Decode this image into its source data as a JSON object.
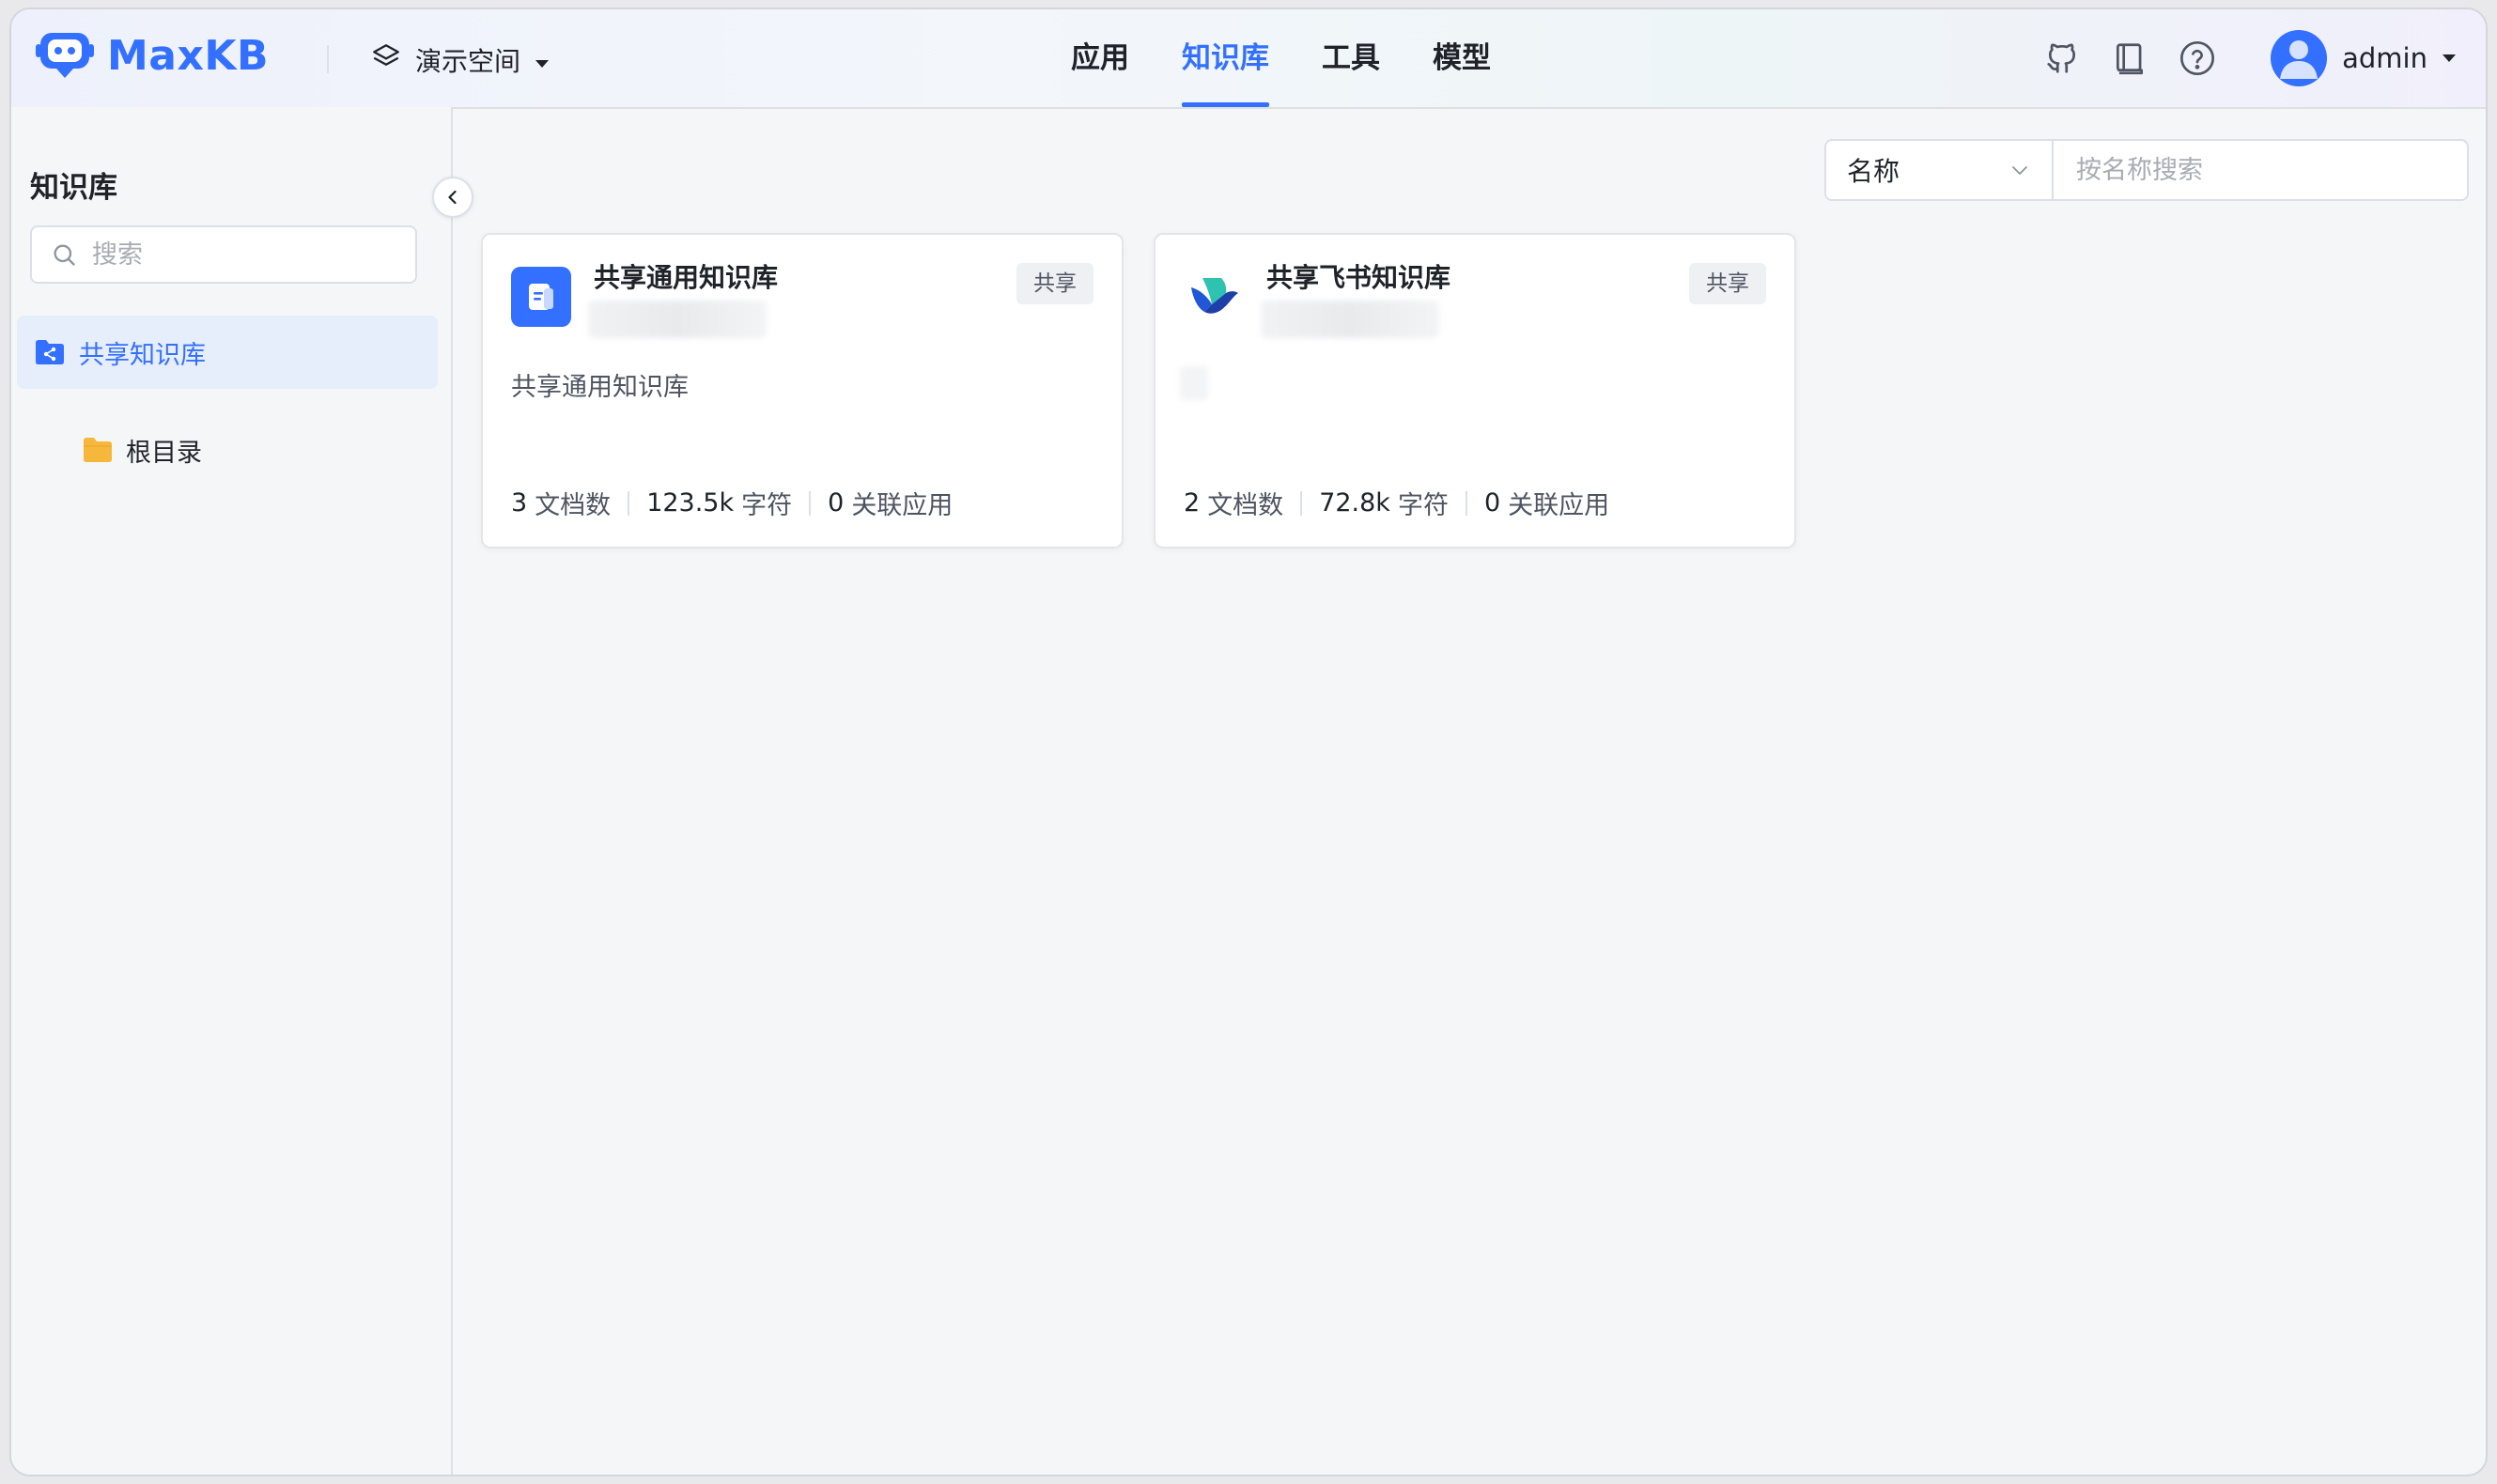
{
  "app": {
    "name": "MaxKB"
  },
  "workspace": {
    "label": "演示空间"
  },
  "nav": {
    "items": [
      {
        "label": "应用",
        "active": false
      },
      {
        "label": "知识库",
        "active": true
      },
      {
        "label": "工具",
        "active": false
      },
      {
        "label": "模型",
        "active": false
      }
    ]
  },
  "header_icons": [
    "github-icon",
    "book-icon",
    "help-icon"
  ],
  "user": {
    "name": "admin"
  },
  "sidebar": {
    "title": "知识库",
    "search_placeholder": "搜索",
    "shared_folder": "共享知识库",
    "root_folder": "根目录"
  },
  "filter": {
    "field": "名称",
    "placeholder": "按名称搜索"
  },
  "cards": [
    {
      "title": "共享通用知识库",
      "tag": "共享",
      "description": "共享通用知识库",
      "docs": "3",
      "docs_label": "文档数",
      "chars": "123.5k",
      "chars_label": "字符",
      "apps": "0",
      "apps_label": "关联应用",
      "icon": "document-icon",
      "icon_color": "#3370ff"
    },
    {
      "title": "共享飞书知识库",
      "tag": "共享",
      "description": "",
      "docs": "2",
      "docs_label": "文档数",
      "chars": "72.8k",
      "chars_label": "字符",
      "apps": "0",
      "apps_label": "关联应用",
      "icon": "lark-icon"
    }
  ],
  "colors": {
    "accent": "#3370ff",
    "folder": "#f5b83d"
  }
}
